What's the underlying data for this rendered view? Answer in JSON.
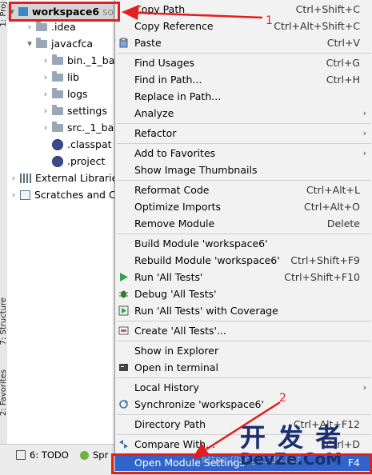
{
  "side_tabs": {
    "project": "1: Proj",
    "structure": "7: Structure",
    "favorites": "2: Favorites"
  },
  "tree": [
    {
      "label": "workspace6",
      "suffix": "so",
      "level": 0,
      "icon": "module-icon",
      "expanded": true,
      "selected": true
    },
    {
      "label": ".idea",
      "level": 1,
      "icon": "folder-icon",
      "expanded": false
    },
    {
      "label": "javacfca",
      "level": 1,
      "icon": "folder-icon",
      "expanded": true
    },
    {
      "label": "bin._1_ba",
      "level": 2,
      "icon": "folder-icon",
      "expanded": false
    },
    {
      "label": "lib",
      "level": 2,
      "icon": "folder-icon",
      "expanded": false
    },
    {
      "label": "logs",
      "level": 2,
      "icon": "folder-icon",
      "expanded": false
    },
    {
      "label": "settings",
      "level": 2,
      "icon": "folder-icon",
      "expanded": false
    },
    {
      "label": "src._1_ba",
      "level": 2,
      "icon": "folder-icon",
      "expanded": false
    },
    {
      "label": ".classpat",
      "level": 2,
      "icon": "classpath-file-icon"
    },
    {
      "label": ".project",
      "level": 2,
      "icon": "project-file-icon"
    },
    {
      "label": "External Librarie",
      "level": 0,
      "icon": "library-icon",
      "expanded": false
    },
    {
      "label": "Scratches and C",
      "level": 0,
      "icon": "scratch-icon",
      "expanded": false
    }
  ],
  "bottom_tabs": {
    "todo": "6: TODO",
    "spring": "Spr"
  },
  "menu": {
    "copy_path": {
      "label": "Copy Path",
      "shortcut": "Ctrl+Shift+C"
    },
    "copy_reference": {
      "label": "Copy Reference",
      "shortcut": "Ctrl+Alt+Shift+C"
    },
    "paste": {
      "label": "Paste",
      "shortcut": "Ctrl+V"
    },
    "find_usages": {
      "label": "Find Usages",
      "shortcut": "Ctrl+G"
    },
    "find_in_path": {
      "label": "Find in Path...",
      "shortcut": "Ctrl+H"
    },
    "replace_in_path": {
      "label": "Replace in Path..."
    },
    "analyze": {
      "label": "Analyze"
    },
    "refactor": {
      "label": "Refactor"
    },
    "add_to_favorites": {
      "label": "Add to Favorites"
    },
    "show_thumbnails": {
      "label": "Show Image Thumbnails"
    },
    "reformat_code": {
      "label": "Reformat Code",
      "shortcut": "Ctrl+Alt+L"
    },
    "optimize_imports": {
      "label": "Optimize Imports",
      "shortcut": "Ctrl+Alt+O"
    },
    "remove_module": {
      "label": "Remove Module",
      "shortcut": "Delete"
    },
    "build_module": {
      "label": "Build Module 'workspace6'"
    },
    "rebuild_module": {
      "label": "Rebuild Module 'workspace6'",
      "shortcut": "Ctrl+Shift+F9"
    },
    "run_tests": {
      "label": "Run 'All Tests'",
      "shortcut": "Ctrl+Shift+F10"
    },
    "debug_tests": {
      "label": "Debug 'All Tests'"
    },
    "run_coverage": {
      "label": "Run 'All Tests' with Coverage"
    },
    "create_tests": {
      "label": "Create 'All Tests'..."
    },
    "show_in_explorer": {
      "label": "Show in Explorer"
    },
    "open_terminal": {
      "label": "Open in terminal"
    },
    "local_history": {
      "label": "Local History"
    },
    "synchronize": {
      "label": "Synchronize 'workspace6'"
    },
    "directory_path": {
      "label": "Directory Path",
      "shortcut": "Ctrl+Alt+F12"
    },
    "compare_with": {
      "label": "Compare With...",
      "shortcut": "Ctrl+D"
    },
    "open_module_settings": {
      "label": "Open Module Settings",
      "shortcut": "F4"
    }
  },
  "annotations": {
    "marker1": "1",
    "marker2": "2"
  },
  "watermark": {
    "cn": "开 发 者",
    "en": "DevZe.CoM",
    "url": "https://blog.csdn.net"
  },
  "colors": {
    "highlight": "#2f65ca",
    "annotation_red": "#e41e1e",
    "run_green": "#2ea44f"
  }
}
